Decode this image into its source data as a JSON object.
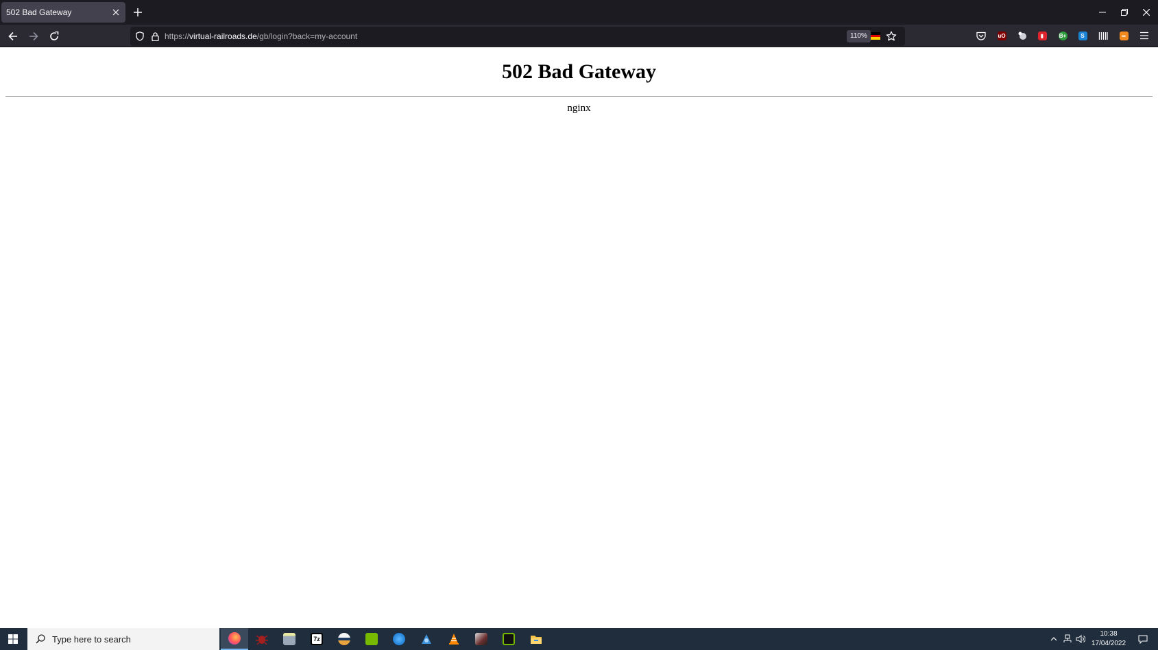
{
  "browser": {
    "tab": {
      "title": "502 Bad Gateway"
    },
    "url": {
      "scheme": "https://",
      "host": "virtual-railroads.de",
      "path": "/gb/login?back=my-account"
    },
    "zoom": "110%"
  },
  "page": {
    "heading": "502 Bad Gateway",
    "server": "nginx"
  },
  "taskbar": {
    "search_placeholder": "Type here to search",
    "time": "10:38",
    "date": "17/04/2022"
  },
  "colors": {
    "tab_bg": "#42414d",
    "titlebar_bg": "#1c1b22",
    "navbar_bg": "#2b2a33",
    "taskbar_bg": "#1f2d3d"
  }
}
